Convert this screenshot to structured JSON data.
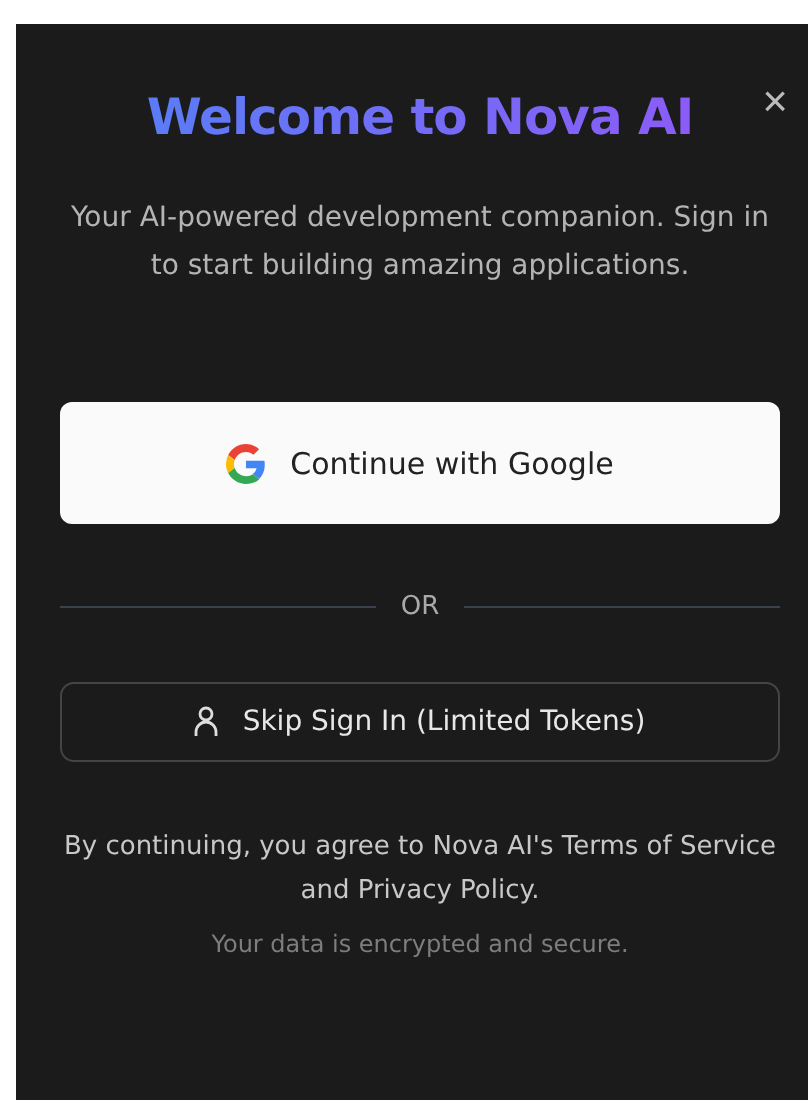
{
  "dialog": {
    "close": "×",
    "title": "Welcome to Nova AI",
    "subtitle": "Your AI-powered development companion. Sign in to start building amazing applications.",
    "google_button": "Continue with Google",
    "divider": "OR",
    "skip_button": "Skip Sign In (Limited Tokens)",
    "legal": "By continuing, you agree to Nova AI's Terms of Service and Privacy Policy.",
    "security_note": "Your data is encrypted and secure."
  }
}
